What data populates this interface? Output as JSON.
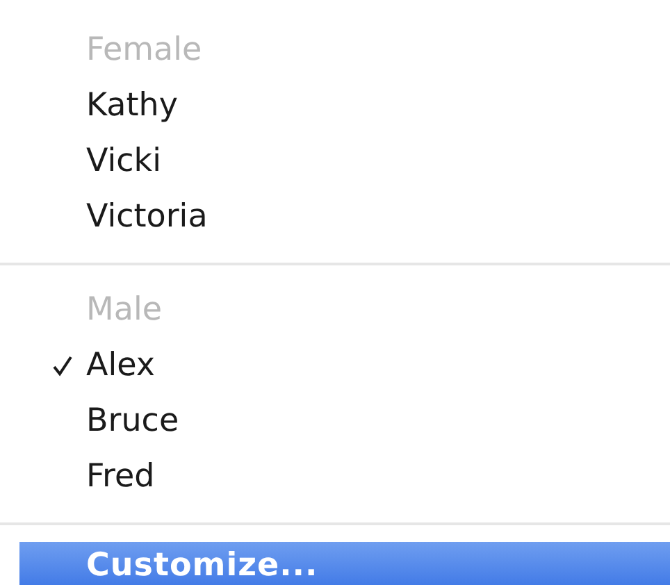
{
  "menu": {
    "sections": [
      {
        "header": "Female",
        "items": [
          {
            "label": "Kathy",
            "checked": false
          },
          {
            "label": "Vicki",
            "checked": false
          },
          {
            "label": "Victoria",
            "checked": false
          }
        ]
      },
      {
        "header": "Male",
        "items": [
          {
            "label": "Alex",
            "checked": true
          },
          {
            "label": "Bruce",
            "checked": false
          },
          {
            "label": "Fred",
            "checked": false
          }
        ]
      }
    ],
    "actions": [
      {
        "label": "Customize...",
        "selected": true
      }
    ]
  }
}
